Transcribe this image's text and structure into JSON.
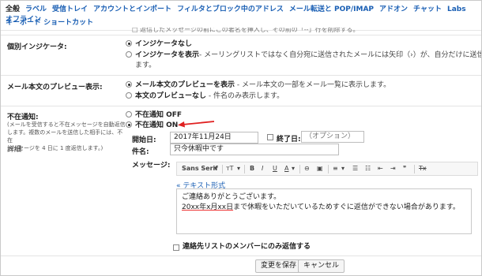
{
  "tabs": {
    "row1": [
      "全般",
      "ラベル",
      "受信トレイ",
      "アカウントとインポート",
      "フィルタとブロック中のアドレス",
      "メール転送と POP/IMAP",
      "アドオン",
      "チャット",
      "Labs",
      "オフライン"
    ],
    "row2": [
      "キーボード ショートカット"
    ]
  },
  "partial_top_line": "□ 返信したメッセージの前にこの著名を挿入し、その前の「--」行を削除する。",
  "indicators": {
    "label": "個別インジケータ:",
    "option_off": "インジケータなし",
    "option_on": "インジケータを表示",
    "option_on_desc": "- メーリングリストではなく自分宛に送信されたメールには矢印（›）が、自分だけに送信されたメールには二重矢印（»）が表示されます。",
    "option_on_desc_line1": "- メーリングリストではなく自分宛に送信されたメールには矢印（›）が、自分だけに送信されたメ",
    "option_on_desc_line2": "ます。"
  },
  "preview": {
    "label": "メール本文のプレビュー表示:",
    "option_on": "メール本文のプレビューを表示",
    "option_on_desc": " - メール本文の一部をメール一覧に表示します。",
    "option_off": "本文のプレビューなし",
    "option_off_desc": " - 件名のみ表示します。"
  },
  "vacation": {
    "label": "不在通知:",
    "sublabel_line1": "(メールを受信すると不在メッセージを自動返信",
    "sublabel_line2": "します。複数のメールを送信した相手には、不在",
    "sublabel_line3": "メッセージを 4 日に 1 度返信します。)",
    "details_link": "詳細",
    "option_off": "不在通知 OFF",
    "option_on": "不在通知 ON",
    "start_label": "開始日:",
    "start_value": "2017年11月24日",
    "end_label": "終了日:",
    "end_placeholder": "（オプション）",
    "subject_label": "件名:",
    "subject_value": "只今休暇中です",
    "message_label": "メッセージ:",
    "plain_text_link": "« テキスト形式",
    "message_line1": "ご連絡ありがとうございます。",
    "message_line2_underlined": "20xx年x月xx日",
    "message_line2_rest": "まで休暇をいただいているためすぐに返信ができない場合があります。",
    "contacts_only": "連絡先リストのメンバーにのみ返信する"
  },
  "toolbar": {
    "font": "Sans Serif",
    "items": [
      "▾",
      "тT",
      "▾",
      "B",
      "I",
      "U",
      "A",
      "▾",
      "⊖",
      "▣",
      "≡",
      "▾",
      "☰",
      "☷",
      "⇤",
      "⇥",
      "❞",
      "Tx"
    ]
  },
  "buttons": {
    "save": "変更を保存",
    "cancel": "キャンセル"
  },
  "annotation": {
    "arrow_color": "#e02020"
  }
}
